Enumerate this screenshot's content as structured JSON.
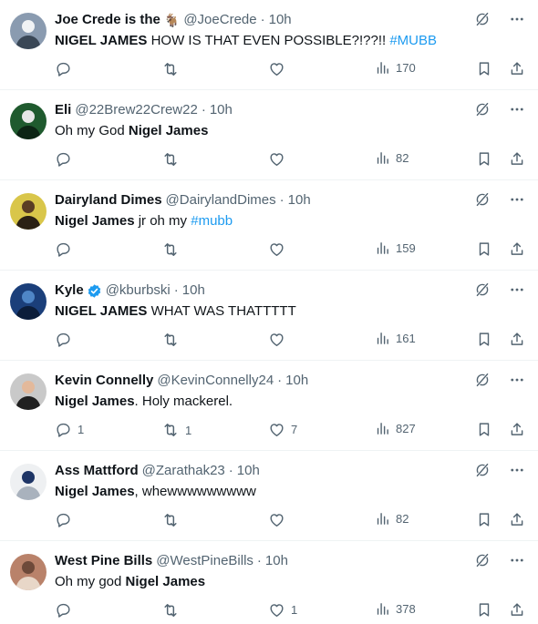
{
  "tweets": [
    {
      "name": "Joe Crede is the",
      "emoji": "🐐",
      "verified": false,
      "handle": "@JoeCrede",
      "time": "10h",
      "segments": [
        {
          "t": "NIGEL JAMES",
          "s": "bold"
        },
        {
          "t": " HOW IS THAT EVEN POSSIBLE?!??!! ",
          "s": ""
        },
        {
          "t": "#MUBB",
          "s": "tag"
        }
      ],
      "replies": "",
      "retweets": "",
      "likes": "",
      "views": "170",
      "avatar_colors": [
        "#8a9bb0",
        "#f1f3f5",
        "#3a4756"
      ]
    },
    {
      "name": "Eli",
      "emoji": "",
      "verified": false,
      "handle": "@22Brew22Crew22",
      "time": "10h",
      "segments": [
        {
          "t": "Oh my God ",
          "s": ""
        },
        {
          "t": "Nigel James",
          "s": "bold"
        }
      ],
      "replies": "",
      "retweets": "",
      "likes": "",
      "views": "82",
      "avatar_colors": [
        "#1f5a2e",
        "#e7e7e7",
        "#0c2414"
      ]
    },
    {
      "name": "Dairyland Dimes",
      "emoji": "",
      "verified": false,
      "handle": "@DairylandDimes",
      "time": "10h",
      "segments": [
        {
          "t": "Nigel James",
          "s": "bold"
        },
        {
          "t": " jr oh my ",
          "s": ""
        },
        {
          "t": "#mubb",
          "s": "tag"
        }
      ],
      "replies": "",
      "retweets": "",
      "likes": "",
      "views": "159",
      "avatar_colors": [
        "#d9c64a",
        "#5a3d24",
        "#2b2114"
      ]
    },
    {
      "name": "Kyle",
      "emoji": "",
      "verified": true,
      "handle": "@kburbski",
      "time": "10h",
      "segments": [
        {
          "t": "NIGEL JAMES",
          "s": "bold"
        },
        {
          "t": " WHAT WAS THATTTTT",
          "s": ""
        }
      ],
      "replies": "",
      "retweets": "",
      "likes": "",
      "views": "161",
      "avatar_colors": [
        "#1b3f7a",
        "#4f86c6",
        "#0b1d3a"
      ]
    },
    {
      "name": "Kevin Connelly",
      "emoji": "",
      "verified": false,
      "handle": "@KevinConnelly24",
      "time": "10h",
      "segments": [
        {
          "t": "Nigel James",
          "s": "bold"
        },
        {
          "t": ". Holy mackerel.",
          "s": ""
        }
      ],
      "replies": "1",
      "retweets": "1",
      "likes": "7",
      "views": "827",
      "avatar_colors": [
        "#c9c9c9",
        "#e3b99b",
        "#202020"
      ]
    },
    {
      "name": "Ass Mattford",
      "emoji": "",
      "verified": false,
      "handle": "@Zarathak23",
      "time": "10h",
      "segments": [
        {
          "t": "Nigel James",
          "s": "bold"
        },
        {
          "t": ", whewwwwwwwww",
          "s": ""
        }
      ],
      "replies": "",
      "retweets": "",
      "likes": "",
      "views": "82",
      "avatar_colors": [
        "#eef0f2",
        "#1e3566",
        "#a9b2bd"
      ]
    },
    {
      "name": "West Pine Bills",
      "emoji": "",
      "verified": false,
      "handle": "@WestPineBills",
      "time": "10h",
      "segments": [
        {
          "t": "Oh my god ",
          "s": ""
        },
        {
          "t": "Nigel James",
          "s": "bold"
        }
      ],
      "replies": "",
      "retweets": "",
      "likes": "1",
      "views": "378",
      "avatar_colors": [
        "#b9826a",
        "#6e4a3a",
        "#e8d7c8"
      ]
    }
  ],
  "icons": {
    "reply": "reply-icon",
    "retweet": "retweet-icon",
    "like": "like-icon",
    "views": "views-icon",
    "bookmark": "bookmark-icon",
    "share": "share-icon",
    "grok": "grok-icon",
    "more": "more-icon",
    "verified": "verified-badge-icon"
  },
  "colors": {
    "text": "#0f1419",
    "secondary": "#536471",
    "link": "#1d9bf0",
    "divider": "#eff3f4",
    "verified": "#1d9bf0"
  }
}
